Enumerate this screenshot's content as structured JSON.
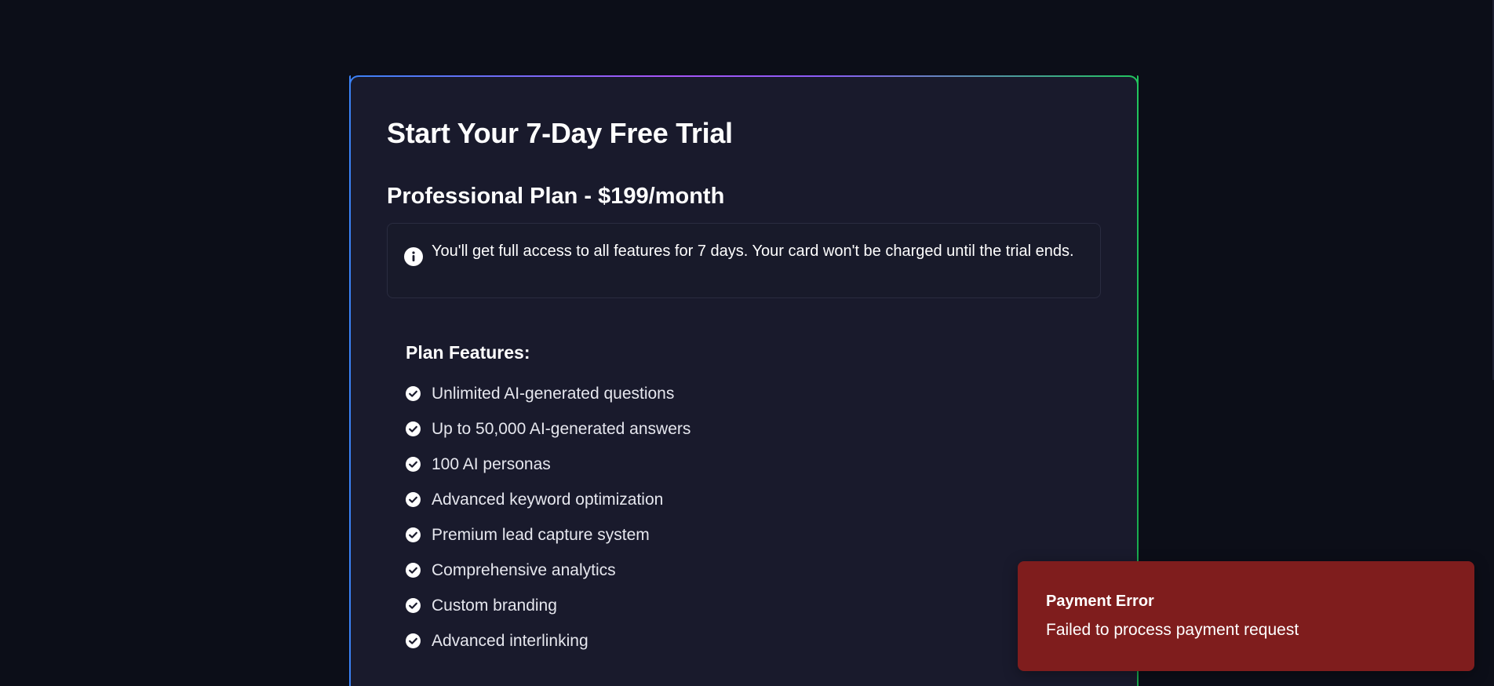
{
  "trial": {
    "title": "Start Your 7-Day Free Trial",
    "plan_name": "Professional Plan - $199/month",
    "info_icon": "info-circle-icon",
    "info_text": "You'll get full access to all features for 7 days. Your card won't be charged until the trial ends."
  },
  "features": {
    "heading": "Plan Features:",
    "icon": "check-circle-icon",
    "items": [
      "Unlimited AI-generated questions",
      "Up to 50,000 AI-generated answers",
      "100 AI personas",
      "Advanced keyword optimization",
      "Premium lead capture system",
      "Comprehensive analytics",
      "Custom branding",
      "Advanced interlinking"
    ]
  },
  "toast": {
    "title": "Payment Error",
    "message": "Failed to process payment request"
  },
  "colors": {
    "background": "#0c0e18",
    "card": "#191a2c",
    "toast": "#7f1d1d",
    "border_gradient_start": "#3b82f6",
    "border_gradient_mid": "#a855f7",
    "border_gradient_end": "#22c55e"
  }
}
